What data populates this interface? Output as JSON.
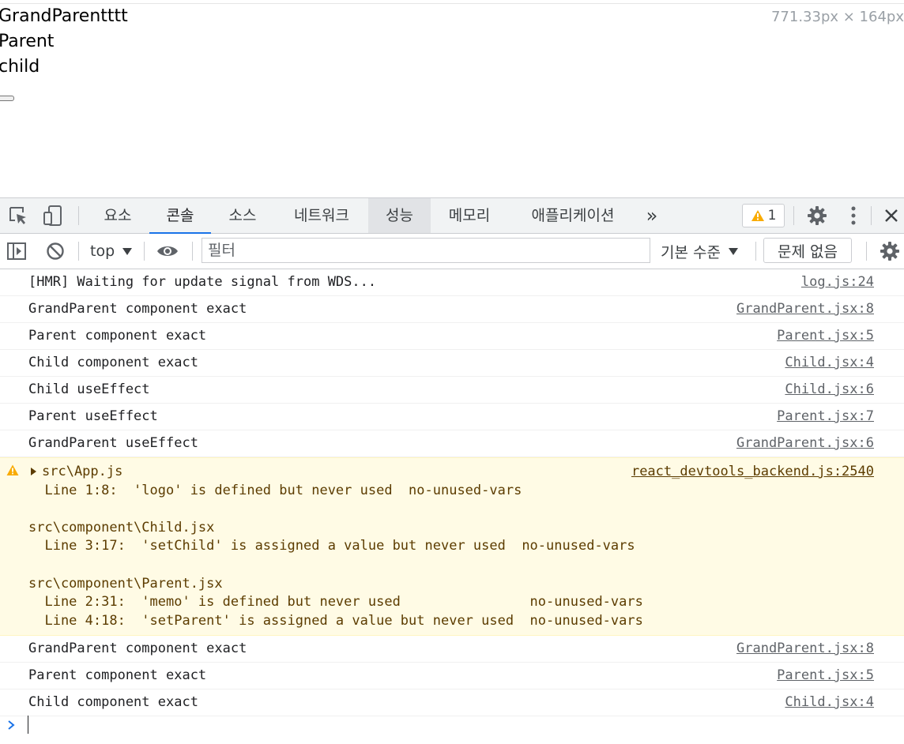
{
  "page": {
    "lines": [
      "GrandParentttt",
      "Parent",
      "child"
    ],
    "dimensions_overlay": "771.33px × 164px"
  },
  "devtools": {
    "tabs": [
      "요소",
      "콘솔",
      "소스",
      "네트워크",
      "성능",
      "메모리",
      "애플리케이션"
    ],
    "active_tab": "콘솔",
    "more_tabs": "»",
    "warning_count": "1",
    "colors": {
      "accent": "#1a73e8",
      "warning_bg": "#fffbe5",
      "warning_text": "#5c3c00",
      "warning_icon": "#f9ab00"
    }
  },
  "toolbar": {
    "context": "top",
    "filter_placeholder": "필터",
    "levels": "기본 수준",
    "issues": "문제 없음"
  },
  "console": {
    "messages": [
      {
        "text": "[HMR] Waiting for update signal from WDS...",
        "source": "log.js:24"
      },
      {
        "text": "GrandParent component exact",
        "source": "GrandParent.jsx:8"
      },
      {
        "text": "Parent component exact",
        "source": "Parent.jsx:5"
      },
      {
        "text": "Child component exact",
        "source": "Child.jsx:4"
      },
      {
        "text": "Child useEffect",
        "source": "Child.jsx:6"
      },
      {
        "text": "Parent useEffect",
        "source": "Parent.jsx:7"
      },
      {
        "text": "GrandParent useEffect",
        "source": "GrandParent.jsx:6"
      }
    ],
    "warning": {
      "first_line": "src\\App.js",
      "rest": "  Line 1:8:  'logo' is defined but never used  no-unused-vars\n\nsrc\\component\\Child.jsx\n  Line 3:17:  'setChild' is assigned a value but never used  no-unused-vars\n\nsrc\\component\\Parent.jsx\n  Line 2:31:  'memo' is defined but never used                no-unused-vars\n  Line 4:18:  'setParent' is assigned a value but never used  no-unused-vars",
      "source": "react_devtools_backend.js:2540"
    },
    "messages_after": [
      {
        "text": "GrandParent component exact",
        "source": "GrandParent.jsx:8"
      },
      {
        "text": "Parent component exact",
        "source": "Parent.jsx:5"
      },
      {
        "text": "Child component exact",
        "source": "Child.jsx:4"
      }
    ]
  }
}
